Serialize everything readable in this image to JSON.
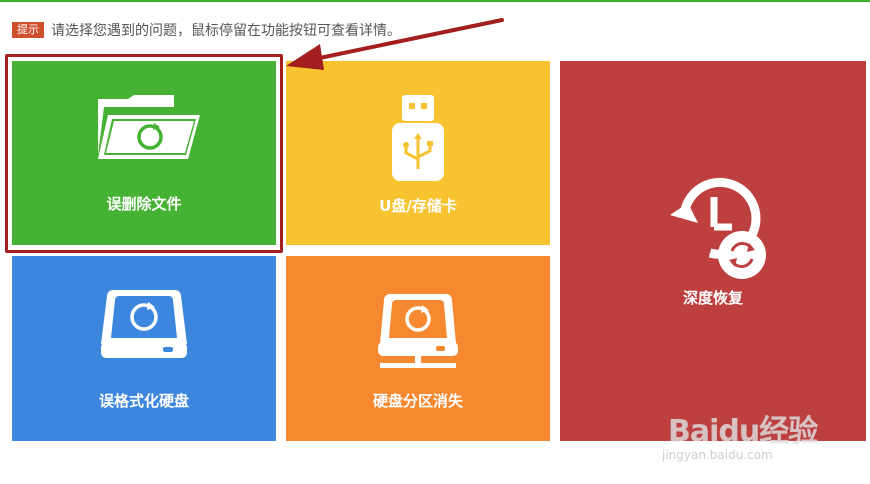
{
  "hint": {
    "badge": "提示",
    "text": "请选择您遇到的问题，鼠标停留在功能按钮可查看详情。"
  },
  "tiles": {
    "deleted_files": {
      "label": "误删除文件",
      "icon": "folder-restore-icon",
      "color": "#45b234"
    },
    "usb_card": {
      "label": "U盘/存储卡",
      "icon": "usb-drive-icon",
      "color": "#f8c330"
    },
    "deep_recovery": {
      "label": "深度恢复",
      "icon": "clock-history-icon",
      "color": "#bd3f3e"
    },
    "formatted_disk": {
      "label": "误格式化硬盘",
      "icon": "hard-disk-icon",
      "color": "#3c86dd"
    },
    "partition_lost": {
      "label": "硬盘分区消失",
      "icon": "network-disk-icon",
      "color": "#f6892f"
    }
  },
  "annotation": {
    "highlight_color": "#a31f1f"
  },
  "watermark": {
    "brand": "Baidu经验",
    "url": "jingyan.baidu.com"
  }
}
